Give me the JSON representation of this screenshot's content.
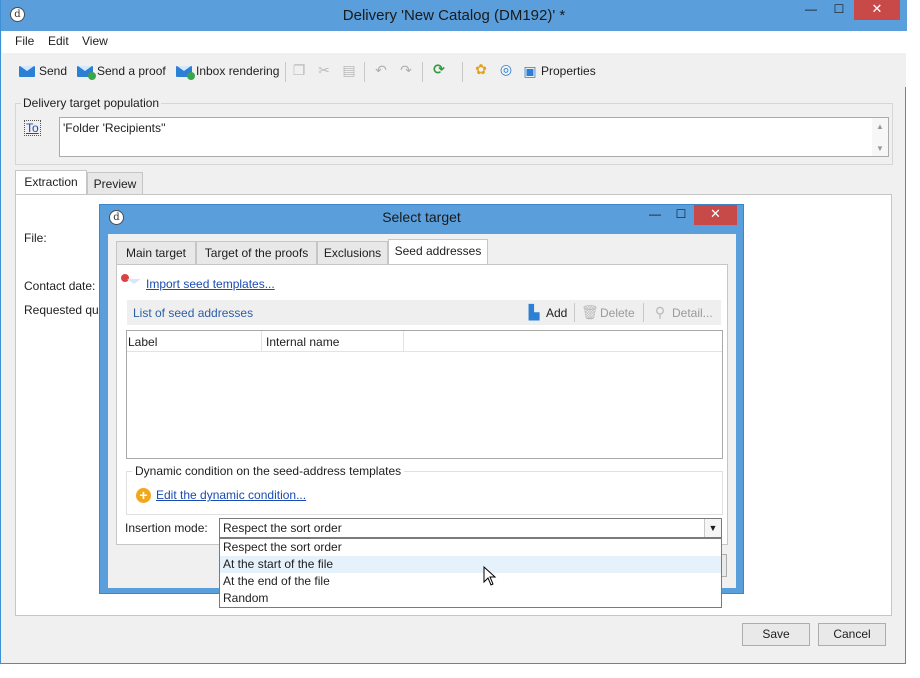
{
  "window": {
    "title": "Delivery 'New Catalog (DM192)' *",
    "minimize": "—",
    "maximize": "☐",
    "close": "✕"
  },
  "menu": [
    "File",
    "Edit",
    "View"
  ],
  "toolbar": {
    "send": "Send",
    "send_proof": "Send a proof",
    "inbox_rendering": "Inbox rendering",
    "properties": "Properties"
  },
  "target_population": {
    "group_label": "Delivery target population",
    "to_label": "To",
    "to_value": "'Folder 'Recipients''"
  },
  "main_tabs": [
    "Extraction",
    "Preview"
  ],
  "extraction": {
    "file_label": "File:",
    "contact_date_label": "Contact date:",
    "requested_label": "Requested qua"
  },
  "buttons": {
    "save": "Save",
    "cancel": "Cancel"
  },
  "dialog": {
    "title": "Select target",
    "tabs": [
      "Main target",
      "Target of the proofs",
      "Exclusions",
      "Seed addresses"
    ],
    "active_tab": "Seed addresses",
    "import_link": "Import seed templates...",
    "list_title": "List of seed addresses",
    "add": "Add",
    "delete": "Delete",
    "detail": "Detail...",
    "columns": [
      "Label",
      "Internal name"
    ],
    "dynamic_group_label": "Dynamic condition on the seed-address templates",
    "edit_condition_link": "Edit the dynamic condition...",
    "insertion_mode_label": "Insertion mode:",
    "insertion_mode_value": "Respect the sort order",
    "insertion_options": [
      "Respect the sort order",
      "At the start of the file",
      "At the end of the file",
      "Random"
    ],
    "hovered_option": "At the start of the file"
  },
  "colors": {
    "titlebar": "#5a9fdc",
    "close_button": "#c74a48",
    "link": "#1a4bb3",
    "window_bg": "#f0f0f0"
  }
}
